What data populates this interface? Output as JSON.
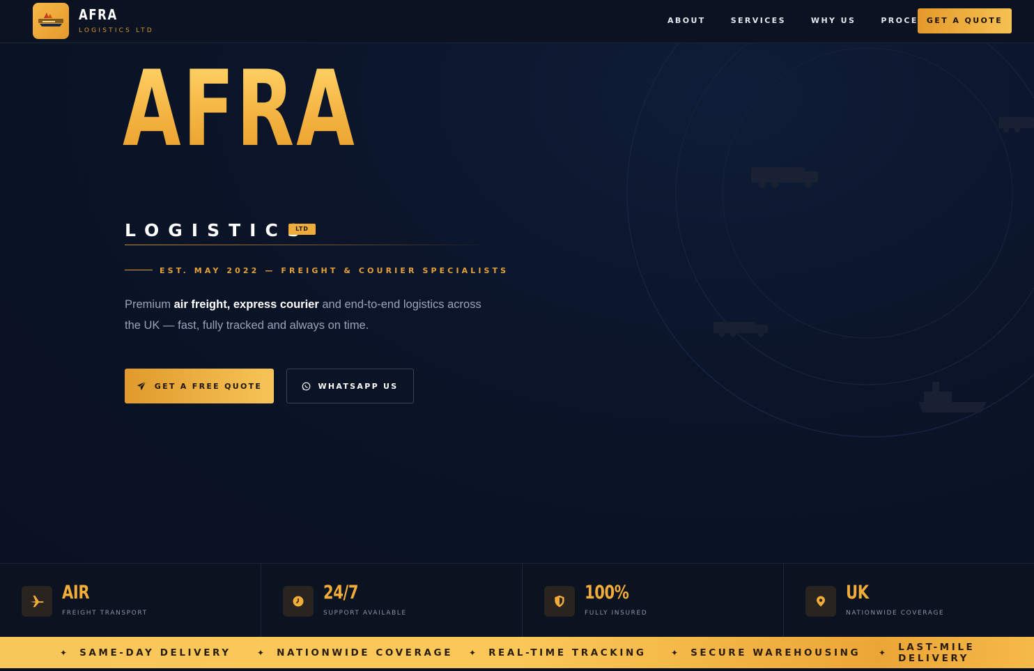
{
  "nav": {
    "brand": "AFRA",
    "brand_sub": "LOGISTICS LTD",
    "links": [
      "ABOUT",
      "SERVICES",
      "WHY US",
      "PROCESS"
    ],
    "cta": "GET A QUOTE"
  },
  "hero": {
    "title": "AFRA",
    "subtitle": "LOGISTICS",
    "badge": "LTD",
    "established": "EST. MAY 2022 — FREIGHT & COURIER SPECIALISTS",
    "desc_prefix": "Premium ",
    "desc_bold": "air freight, express courier",
    "desc_suffix": " and end-to-end logistics across the UK — fast, fully tracked and always on time.",
    "primary_button": "GET A FREE QUOTE",
    "secondary_button": "WHATSAPP US"
  },
  "stats": [
    {
      "value": "AIR",
      "label": "FREIGHT TRANSPORT",
      "icon": "plane-icon"
    },
    {
      "value": "24/7",
      "label": "SUPPORT AVAILABLE",
      "icon": "clock-icon"
    },
    {
      "value": "100%",
      "label": "FULLY INSURED",
      "icon": "shield-icon"
    },
    {
      "value": "UK",
      "label": "NATIONWIDE COVERAGE",
      "icon": "map-pin-icon"
    }
  ],
  "ticker": [
    "SAME-DAY DELIVERY",
    "NATIONWIDE COVERAGE",
    "REAL-TIME TRACKING",
    "SECURE WAREHOUSING",
    "LAST-MILE DELIVERY"
  ],
  "colors": {
    "accent": "#f2ac3a",
    "background": "#0a1020",
    "ticker": "#f8c75a"
  }
}
